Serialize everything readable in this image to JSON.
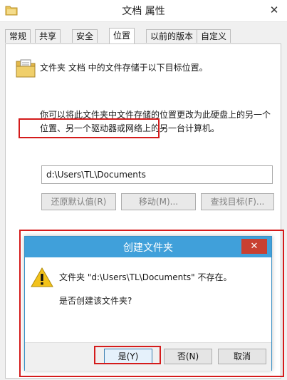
{
  "window": {
    "title": "文档 属性",
    "close_glyph": "✕"
  },
  "tabs": [
    {
      "label": "常规",
      "active": false
    },
    {
      "label": "共享",
      "active": false
    },
    {
      "label": "安全",
      "active": false
    },
    {
      "label": "位置",
      "active": true
    },
    {
      "label": "以前的版本",
      "active": false
    },
    {
      "label": "自定义",
      "active": false
    }
  ],
  "location": {
    "info_text": "文件夹 文档 中的文件存储于以下目标位置。",
    "description_lines": [
      "你可以将此文件夹中文件存储的位置更改为此硬盘上的另一个",
      "位置、另一个驱动器或网络上的另一台计算机。"
    ],
    "path_value": "d:\\Users\\TL\\Documents",
    "buttons": {
      "restore_default": "还原默认值(R)",
      "move": "移动(M)...",
      "find_target": "查找目标(F)..."
    }
  },
  "dialog": {
    "title": "创建文件夹",
    "close_glyph": "✕",
    "message": "文件夹 \"d:\\Users\\TL\\Documents\" 不存在。",
    "question": "是否创建该文件夹?",
    "buttons": {
      "yes": "是(Y)",
      "no": "否(N)",
      "cancel": "取消"
    }
  },
  "colors": {
    "dialog_titlebar": "#40a0da",
    "dialog_close": "#c84031",
    "highlight_box": "#d41b1b"
  },
  "icons": {
    "app": "folder-icon",
    "info": "folder-document-icon",
    "dialog": "warning-icon"
  }
}
